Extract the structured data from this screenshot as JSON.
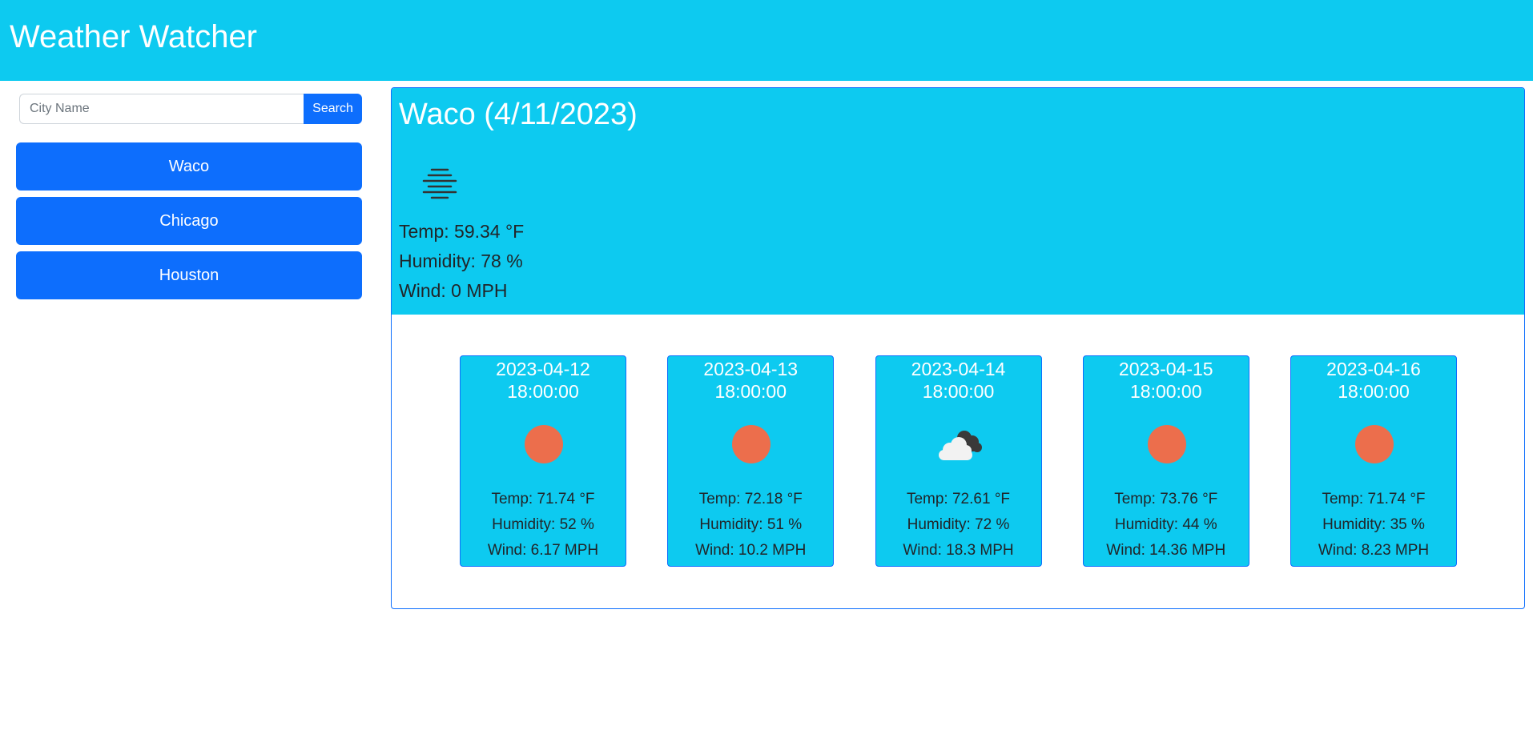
{
  "header": {
    "title": "Weather Watcher"
  },
  "search": {
    "placeholder": "City Name",
    "value": "",
    "button_label": "Search"
  },
  "history": [
    {
      "label": "Waco"
    },
    {
      "label": "Chicago"
    },
    {
      "label": "Houston"
    }
  ],
  "current": {
    "title": "Waco (4/11/2023)",
    "icon": "mist-icon",
    "temp": "Temp: 59.34 °F",
    "humidity": "Humidity: 78 %",
    "wind": "Wind: 0 MPH"
  },
  "forecast": [
    {
      "date": "2023-04-12",
      "time": "18:00:00",
      "icon": "sun-icon",
      "temp": "Temp: 71.74 °F",
      "humidity": "Humidity: 52 %",
      "wind": "Wind: 6.17 MPH"
    },
    {
      "date": "2023-04-13",
      "time": "18:00:00",
      "icon": "sun-icon",
      "temp": "Temp: 72.18 °F",
      "humidity": "Humidity: 51 %",
      "wind": "Wind: 10.2 MPH"
    },
    {
      "date": "2023-04-14",
      "time": "18:00:00",
      "icon": "broken-clouds-icon",
      "temp": "Temp: 72.61 °F",
      "humidity": "Humidity: 72 %",
      "wind": "Wind: 18.3 MPH"
    },
    {
      "date": "2023-04-15",
      "time": "18:00:00",
      "icon": "sun-icon",
      "temp": "Temp: 73.76 °F",
      "humidity": "Humidity: 44 %",
      "wind": "Wind: 14.36 MPH"
    },
    {
      "date": "2023-04-16",
      "time": "18:00:00",
      "icon": "sun-icon",
      "temp": "Temp: 71.74 °F",
      "humidity": "Humidity: 35 %",
      "wind": "Wind: 8.23 MPH"
    }
  ],
  "colors": {
    "header_bg": "#0dcaf0",
    "primary_button": "#0d6efd",
    "sun": "#ec6e4c"
  }
}
